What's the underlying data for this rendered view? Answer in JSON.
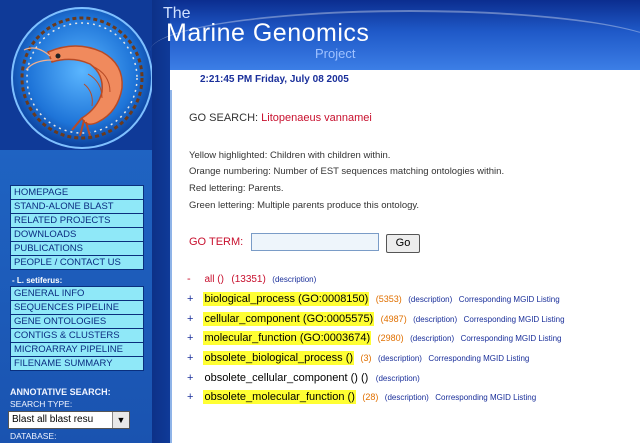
{
  "header": {
    "title_the": "The",
    "title_main": "Marine Genomics",
    "title_project": "Project",
    "datetime": "2:21:45 PM Friday, July 08 2005"
  },
  "sidebar": {
    "nav_main": [
      "HOMEPAGE",
      "STAND-ALONE BLAST",
      "RELATED PROJECTS",
      "DOWNLOADS",
      "PUBLICATIONS",
      "PEOPLE / CONTACT US"
    ],
    "species_label": "- L. setiferus:",
    "nav_species": [
      "GENERAL INFO",
      "SEQUENCES PIPELINE",
      "GENE ONTOLOGIES",
      "CONTIGS & CLUSTERS",
      "MICROARRAY PIPELINE",
      "FILENAME SUMMARY"
    ],
    "annotative_search_label": "ANNOTATIVE SEARCH:",
    "search_type_label": "SEARCH TYPE:",
    "search_type_value": "Blast all blast resu",
    "database_label": "DATABASE:"
  },
  "main": {
    "heading_prefix": "GO SEARCH:",
    "heading_species": "Litopenaeus vannamei",
    "legend": [
      "Yellow highlighted: Children with children within.",
      "Orange numbering: Number of EST sequences matching ontologies within.",
      "Red lettering: Parents.",
      "Green lettering: Multiple parents produce this ontology."
    ],
    "go_term_label": "GO TERM:",
    "go_term_value": "",
    "go_button_label": "Go",
    "tree": [
      {
        "toggle": "-",
        "term": "all ()",
        "count": "(13351)",
        "description": "(description)",
        "mgid": ""
      },
      {
        "toggle": "+",
        "term": "biological_process (GO:0008150)",
        "count": "(5353)",
        "description": "(description)",
        "mgid": "Corresponding MGID Listing"
      },
      {
        "toggle": "+",
        "term": "cellular_component (GO:0005575)",
        "count": "(4987)",
        "description": "(description)",
        "mgid": "Corresponding MGID Listing"
      },
      {
        "toggle": "+",
        "term": "molecular_function (GO:0003674)",
        "count": "(2980)",
        "description": "(description)",
        "mgid": "Corresponding MGID Listing"
      },
      {
        "toggle": "+",
        "term": "obsolete_biological_process ()",
        "count": "(3)",
        "description": "(description)",
        "mgid": "Corresponding MGID Listing"
      },
      {
        "toggle": "+",
        "term": "obsolete_cellular_component () ()",
        "count": "",
        "description": "(description)",
        "mgid": ""
      },
      {
        "toggle": "+",
        "term": "obsolete_molecular_function ()",
        "count": "(28)",
        "description": "(description)",
        "mgid": "Corresponding MGID Listing"
      }
    ]
  },
  "colors": {
    "header_blue": "#1f59c8",
    "sidebar_blue": "#0f3a98",
    "nav_cyan": "#8fe8f8",
    "highlight_yellow": "#ffff33",
    "parent_red": "#c8102e",
    "count_orange": "#e07000",
    "link_blue": "#1a2f9a"
  }
}
